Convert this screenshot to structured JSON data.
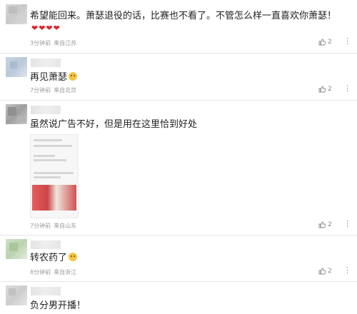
{
  "comments": [
    {
      "text": "希望能回来。萧瑟退役的话，比赛也不看了。不管怎么样一直喜欢你萧瑟！",
      "hearts": "❤❤❤❤",
      "time": "3分钟前",
      "location": "来自江苏",
      "likes": "2"
    },
    {
      "text": "再见萧瑟",
      "time": "7分钟前",
      "location": "来自北京",
      "likes": "2"
    },
    {
      "text": "虽然说广告不好，但是用在这里恰到好处",
      "time": "7分钟前",
      "location": "来自山东",
      "likes": "2"
    },
    {
      "text": "转农药了",
      "time": "8分钟前",
      "location": "来自浙江",
      "likes": "2"
    },
    {
      "text": "负分男开播！"
    }
  ],
  "icons": {
    "like": "thumbs-up-icon",
    "more": "more-options-icon"
  },
  "colors": {
    "heart": "#d9272e",
    "meta": "#9a9a9a",
    "separator": "#e6e6e6"
  }
}
